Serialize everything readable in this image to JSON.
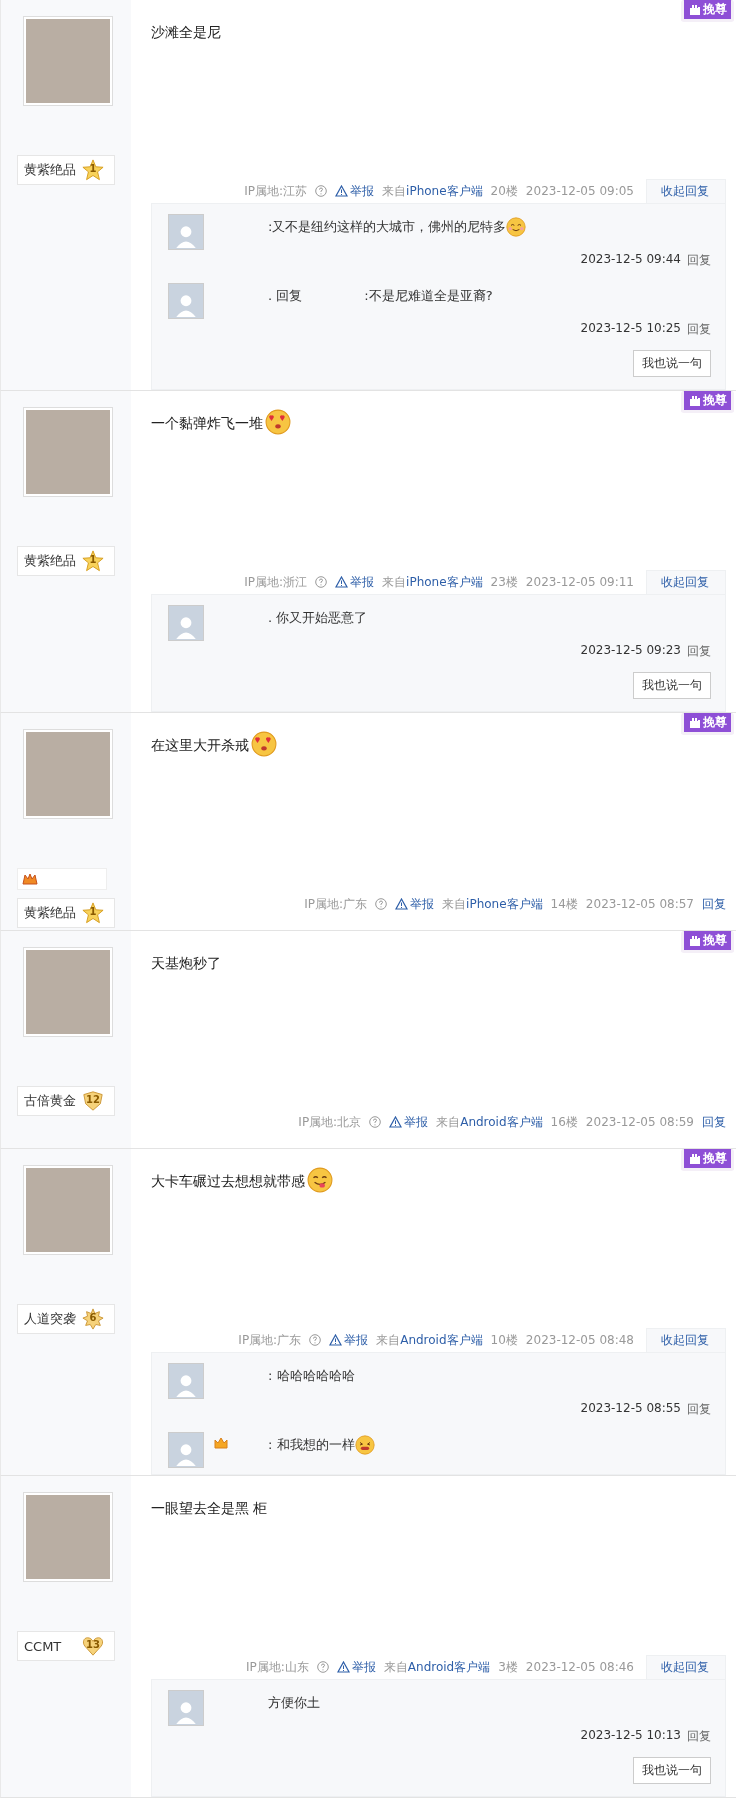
{
  "posts": [
    {
      "action_tag": "挽尊",
      "user_badge": {
        "name": "黄紫绝品",
        "level": "1",
        "kind": "star"
      },
      "text": "沙滩全是尼",
      "meta": {
        "ip": "IP属地:江苏",
        "report": "举报",
        "source_prefix": "来自",
        "source": "iPhone客户端",
        "floor": "20楼",
        "time": "2023-12-05 09:05",
        "toggle": "收起回复",
        "expanded": true
      },
      "replies": [
        {
          "parts": [
            ":又不是纽约这样的大城市，佛州的尼特多"
          ],
          "emoji": {
            "kind": "smile"
          },
          "time": "2023-12-5 09:44",
          "reply_link": "回复"
        },
        {
          "parts": [
            ". 回复",
            ":不是尼难道全是亚裔?"
          ],
          "time": "2023-12-5 10:25",
          "reply_link": "回复"
        }
      ],
      "say_button": "我也说一句"
    },
    {
      "action_tag": "挽尊",
      "user_badge": {
        "name": "黄紫绝品",
        "level": "1",
        "kind": "star"
      },
      "text": "一个黏弹炸飞一堆",
      "emoji": {
        "kind": "heart-eyes"
      },
      "meta": {
        "ip": "IP属地:浙江",
        "report": "举报",
        "source_prefix": "来自",
        "source": "iPhone客户端",
        "floor": "23楼",
        "time": "2023-12-05 09:11",
        "toggle": "收起回复",
        "expanded": true
      },
      "replies": [
        {
          "parts": [
            ". 你又开始恶意了"
          ],
          "time": "2023-12-5 09:23",
          "reply_link": "回复"
        }
      ],
      "say_button": "我也说一句"
    },
    {
      "action_tag": "挽尊",
      "medal": true,
      "user_badge": {
        "name": "黄紫绝品",
        "level": "1",
        "kind": "star"
      },
      "text": "在这里大开杀戒",
      "emoji": {
        "kind": "heart-eyes"
      },
      "meta": {
        "ip": "IP属地:广东",
        "report": "举报",
        "source_prefix": "来自",
        "source": "iPhone客户端",
        "floor": "14楼",
        "time": "2023-12-05 08:57",
        "toggle": "回复",
        "expanded": false
      }
    },
    {
      "action_tag": "挽尊",
      "user_badge": {
        "name": "古倍黄金",
        "level": "12",
        "kind": "shield"
      },
      "text": "天基炮秒了",
      "meta": {
        "ip": "IP属地:北京",
        "report": "举报",
        "source_prefix": "来自",
        "source": "Android客户端",
        "floor": "16楼",
        "time": "2023-12-05 08:59",
        "toggle": "回复",
        "expanded": false
      }
    },
    {
      "action_tag": "挽尊",
      "user_badge": {
        "name": "人道突袭",
        "level": "6",
        "kind": "burst"
      },
      "text": "大卡车碾过去想想就带感",
      "emoji": {
        "kind": "tongue"
      },
      "meta": {
        "ip": "IP属地:广东",
        "report": "举报",
        "source_prefix": "来自",
        "source": "Android客户端",
        "floor": "10楼",
        "time": "2023-12-05 08:48",
        "toggle": "收起回复",
        "expanded": true
      },
      "replies": [
        {
          "parts": [
            ": 哈哈哈哈哈哈"
          ],
          "time": "2023-12-5 08:55",
          "reply_link": "回复"
        },
        {
          "parts": [
            ": 和我想的一样"
          ],
          "emoji": {
            "kind": "grin"
          },
          "vip": true
        }
      ]
    },
    {
      "user_badge": {
        "name": "CCMT",
        "level": "13",
        "kind": "heart"
      },
      "text": "一眼望去全是黑 柜",
      "meta": {
        "ip": "IP属地:山东",
        "report": "举报",
        "source_prefix": "来自",
        "source": "Android客户端",
        "floor": "3楼",
        "time": "2023-12-05 08:46",
        "toggle": "收起回复",
        "expanded": true
      },
      "replies": [
        {
          "parts": [
            "方便你土"
          ],
          "time": "2023-12-5 10:13",
          "reply_link": "回复"
        }
      ],
      "say_button": "我也说一句"
    }
  ]
}
